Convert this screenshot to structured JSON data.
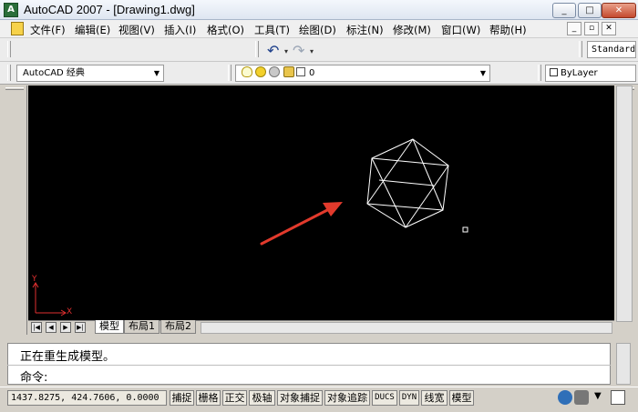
{
  "window": {
    "title": "AutoCAD 2007 - [Drawing1.dwg]",
    "app_icon_text": "A",
    "minimize": "_",
    "maximize": "□",
    "close": "✕"
  },
  "mdi": {
    "minimize": "_",
    "restore": "▫",
    "close": "✕"
  },
  "menu": {
    "items": [
      "文件(F)",
      "编辑(E)",
      "视图(V)",
      "插入(I)",
      "格式(O)",
      "工具(T)",
      "绘图(D)",
      "标注(N)",
      "修改(M)",
      "窗口(W)",
      "帮助(H)"
    ]
  },
  "toolbar": {
    "text_style": "Standard",
    "undo_icon": "↶",
    "redo_icon": "↷",
    "workspace": "AutoCAD 经典",
    "layer_name": "0",
    "color": "ByLayer"
  },
  "layout_tabs": [
    "模型",
    "布局1",
    "布局2"
  ],
  "nav_buttons": [
    "|◀",
    "◀",
    "▶",
    "▶|"
  ],
  "ucs": {
    "x_label": "X",
    "y_label": "Y"
  },
  "command": {
    "history": "正在重生成模型。",
    "prompt": "命令:"
  },
  "status": {
    "coords": "1437.8275, 424.7606, 0.0000",
    "toggles": [
      "捕捉",
      "栅格",
      "正交",
      "极轴",
      "对象捕捉",
      "对象追踪",
      "DUCS",
      "DYN",
      "线宽",
      "模型"
    ]
  },
  "colors": {
    "canvas": "#000000",
    "wireframe": "#ffffff",
    "arrow": "#e23a2c",
    "ucs": "#e03030"
  }
}
